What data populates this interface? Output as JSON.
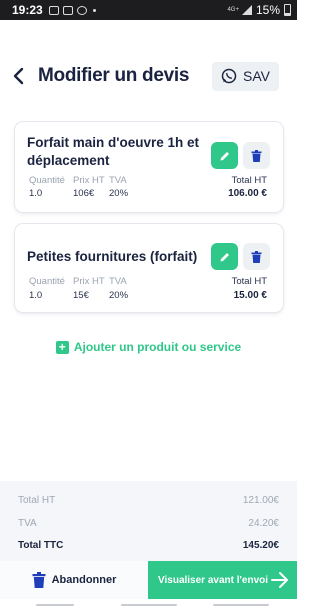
{
  "status_bar": {
    "time": "19:23",
    "network": "4G+",
    "battery": "15%"
  },
  "header": {
    "title": "Modifier un devis",
    "sav_label": "SAV"
  },
  "items": [
    {
      "name": "Forfait main d'oeuvre 1h et déplacement",
      "labels": {
        "quantity": "Quantité",
        "price": "Prix HT",
        "tva": "TVA",
        "total": "Total HT"
      },
      "quantity": "1.0",
      "price": "106€",
      "tva": "20%",
      "total": "106.00 €"
    },
    {
      "name": "Petites fournitures (forfait)",
      "labels": {
        "quantity": "Quantité",
        "price": "Prix HT",
        "tva": "TVA",
        "total": "Total HT"
      },
      "quantity": "1.0",
      "price": "15€",
      "tva": "20%",
      "total": "15.00 €"
    }
  ],
  "add_product_label": "Ajouter un produit ou service",
  "summary": {
    "total_ht_label": "Total HT",
    "total_ht": "121.00€",
    "tva_label": "TVA",
    "tva": "24.20€",
    "total_ttc_label": "Total TTC",
    "total_ttc": "145.20€"
  },
  "actions": {
    "abandon_label": "Abandonner",
    "preview_label": "Visualiser avant l'envoi"
  },
  "colors": {
    "accent": "#2fc88a",
    "text": "#1a2340",
    "muted": "#9aa3b0",
    "delete": "#1f3fb8"
  }
}
